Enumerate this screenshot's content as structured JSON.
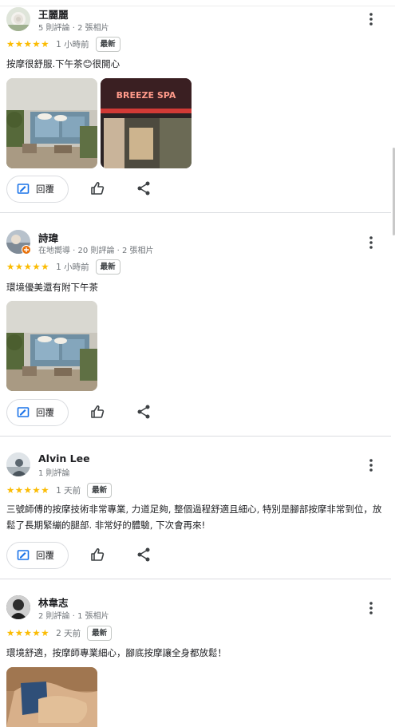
{
  "reviews": [
    {
      "name": "王麗麗",
      "meta": "5 則評論 · 2 張相片",
      "stars": "★★★★★",
      "time": "1 小時前",
      "badge": "最新",
      "text": "按摩很舒服.下午茶😊很開心",
      "photos": [
        "lounge-interior-photo",
        "breeze-spa-sign-photo"
      ]
    },
    {
      "name": "詩瑋",
      "meta": "在地嚮導 · 20 則評論 · 2 張相片",
      "stars": "★★★★★",
      "time": "1 小時前",
      "badge": "最新",
      "text": "環境優美還有附下午茶",
      "photos": [
        "lounge-interior-photo"
      ]
    },
    {
      "name": "Alvin Lee",
      "meta": "1 則評論",
      "stars": "★★★★★",
      "time": "1 天前",
      "badge": "最新",
      "text": "三號師傅的按摩技術非常專業, 力道足夠, 整個過程舒適且細心, 特別是腳部按摩非常到位，放鬆了長期緊繃的腿部. 非常好的體驗, 下次會再來!",
      "photos": []
    },
    {
      "name": "林韋志",
      "meta": "2 則評論 · 1 張相片",
      "stars": "★★★★★",
      "time": "2 天前",
      "badge": "最新",
      "text": "環境舒適，按摩師專業細心，腳底按摩讓全身都放鬆！",
      "photos": [
        "foot-massage-photo"
      ]
    }
  ],
  "actions": {
    "reply_label": "回覆"
  },
  "photo_sign_text": "BREEZE SPA",
  "colors": {
    "star": "#fbbc04",
    "divider": "#dadce0",
    "icon": "#3c4043",
    "reply_icon": "#1a73e8"
  }
}
